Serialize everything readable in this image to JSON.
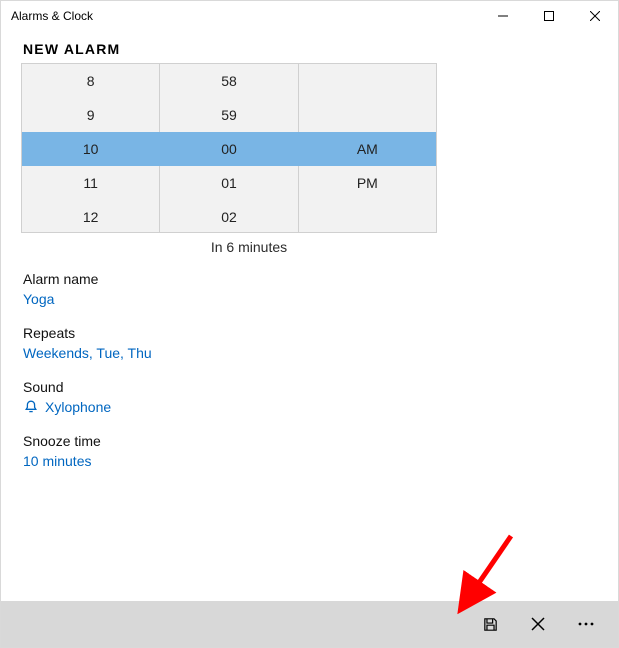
{
  "window": {
    "title": "Alarms & Clock"
  },
  "header": "NEW ALARM",
  "picker": {
    "hours": [
      "8",
      "9",
      "10",
      "11",
      "12"
    ],
    "minutes": [
      "58",
      "59",
      "00",
      "01",
      "02"
    ],
    "ampm": [
      "",
      "",
      "AM",
      "PM",
      ""
    ],
    "caption": "In 6 minutes"
  },
  "fields": {
    "name_label": "Alarm name",
    "name_value": "Yoga",
    "repeats_label": "Repeats",
    "repeats_value": "Weekends, Tue, Thu",
    "sound_label": "Sound",
    "sound_value": "Xylophone",
    "snooze_label": "Snooze time",
    "snooze_value": "10 minutes"
  },
  "commands": {
    "save": "Save",
    "cancel": "Cancel",
    "more": "More"
  }
}
